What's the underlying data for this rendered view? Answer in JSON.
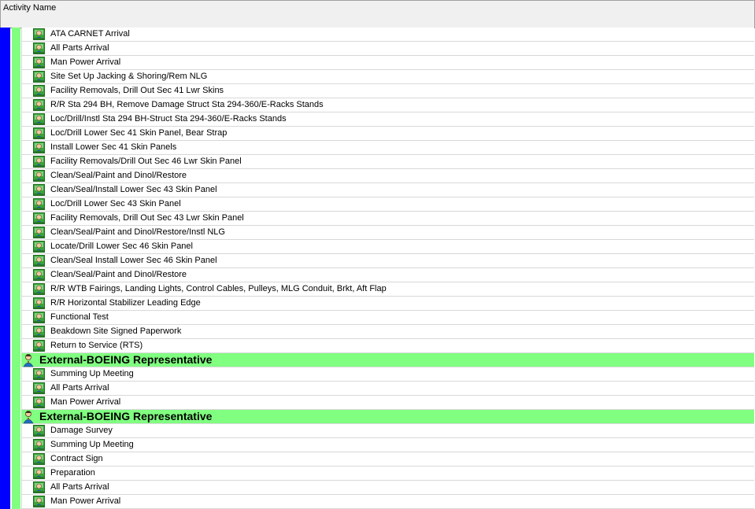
{
  "header": {
    "column_title": "Activity Name"
  },
  "colors": {
    "owner_bar": "#0000ff",
    "group_bar": "#80ff80",
    "group_row": "#80ff80"
  },
  "rows": [
    {
      "type": "task",
      "icon": "task-person-icon",
      "label": "ATA CARNET Arrival"
    },
    {
      "type": "task",
      "icon": "task-person-icon",
      "label": "All Parts Arrival"
    },
    {
      "type": "task",
      "icon": "task-person-icon",
      "label": "Man Power Arrival"
    },
    {
      "type": "task",
      "icon": "task-person-icon",
      "label": "Site Set Up Jacking & Shoring/Rem NLG"
    },
    {
      "type": "task",
      "icon": "task-person-icon",
      "label": "Facility Removals, Drill Out Sec 41 Lwr Skins"
    },
    {
      "type": "task",
      "icon": "task-person-icon",
      "label": "R/R Sta 294 BH, Remove Damage Struct Sta 294-360/E-Racks Stands"
    },
    {
      "type": "task",
      "icon": "task-person-icon",
      "label": "Loc/Drill/Instl Sta 294 BH-Struct Sta 294-360/E-Racks Stands"
    },
    {
      "type": "task",
      "icon": "task-person-icon",
      "label": "Loc/Drill Lower Sec 41 Skin Panel, Bear Strap"
    },
    {
      "type": "task",
      "icon": "task-person-icon",
      "label": "Install Lower Sec 41 Skin Panels"
    },
    {
      "type": "task",
      "icon": "task-person-icon",
      "label": "Facility Removals/Drill Out Sec 46 Lwr Skin Panel"
    },
    {
      "type": "task",
      "icon": "task-person-icon",
      "label": "Clean/Seal/Paint and Dinol/Restore"
    },
    {
      "type": "task",
      "icon": "task-person-icon",
      "label": "Clean/Seal/Install Lower Sec 43 Skin Panel"
    },
    {
      "type": "task",
      "icon": "task-person-icon",
      "label": "Loc/Drill Lower Sec 43 Skin Panel"
    },
    {
      "type": "task",
      "icon": "task-person-icon",
      "label": "Facility Removals, Drill Out Sec 43 Lwr Skin Panel"
    },
    {
      "type": "task",
      "icon": "task-person-icon",
      "label": "Clean/Seal/Paint and Dinol/Restore/Instl NLG"
    },
    {
      "type": "task",
      "icon": "task-person-icon",
      "label": "Locate/Drill Lower Sec 46 Skin Panel"
    },
    {
      "type": "task",
      "icon": "task-person-icon",
      "label": "Clean/Seal Install Lower Sec 46 Skin Panel"
    },
    {
      "type": "task",
      "icon": "task-person-icon",
      "label": "Clean/Seal/Paint and Dinol/Restore"
    },
    {
      "type": "task",
      "icon": "task-person-icon",
      "label": "R/R WTB Fairings, Landing Lights, Control Cables, Pulleys, MLG Conduit, Brkt, Aft Flap"
    },
    {
      "type": "task",
      "icon": "task-person-icon",
      "label": "R/R Horizontal Stabilizer Leading Edge"
    },
    {
      "type": "task",
      "icon": "task-person-icon",
      "label": "Functional Test"
    },
    {
      "type": "task",
      "icon": "task-person-icon",
      "label": "Beakdown Site Signed Paperwork"
    },
    {
      "type": "task",
      "icon": "task-person-icon",
      "label": "Return to Service (RTS)"
    },
    {
      "type": "group",
      "icon": "representative-person-icon",
      "label": "External-BOEING Representative"
    },
    {
      "type": "task",
      "icon": "task-person-icon",
      "label": "Summing Up Meeting"
    },
    {
      "type": "task",
      "icon": "task-person-icon",
      "label": "All Parts Arrival"
    },
    {
      "type": "task",
      "icon": "task-person-icon",
      "label": "Man Power Arrival"
    },
    {
      "type": "group",
      "icon": "representative-person-icon",
      "label": "External-BOEING Representative"
    },
    {
      "type": "task",
      "icon": "task-person-icon",
      "label": "Damage Survey"
    },
    {
      "type": "task",
      "icon": "task-person-icon",
      "label": "Summing Up Meeting"
    },
    {
      "type": "task",
      "icon": "task-person-icon",
      "label": "Contract Sign"
    },
    {
      "type": "task",
      "icon": "task-person-icon",
      "label": "Preparation"
    },
    {
      "type": "task",
      "icon": "task-person-icon",
      "label": "All Parts Arrival"
    },
    {
      "type": "task",
      "icon": "task-person-icon",
      "label": "Man Power Arrival"
    }
  ]
}
